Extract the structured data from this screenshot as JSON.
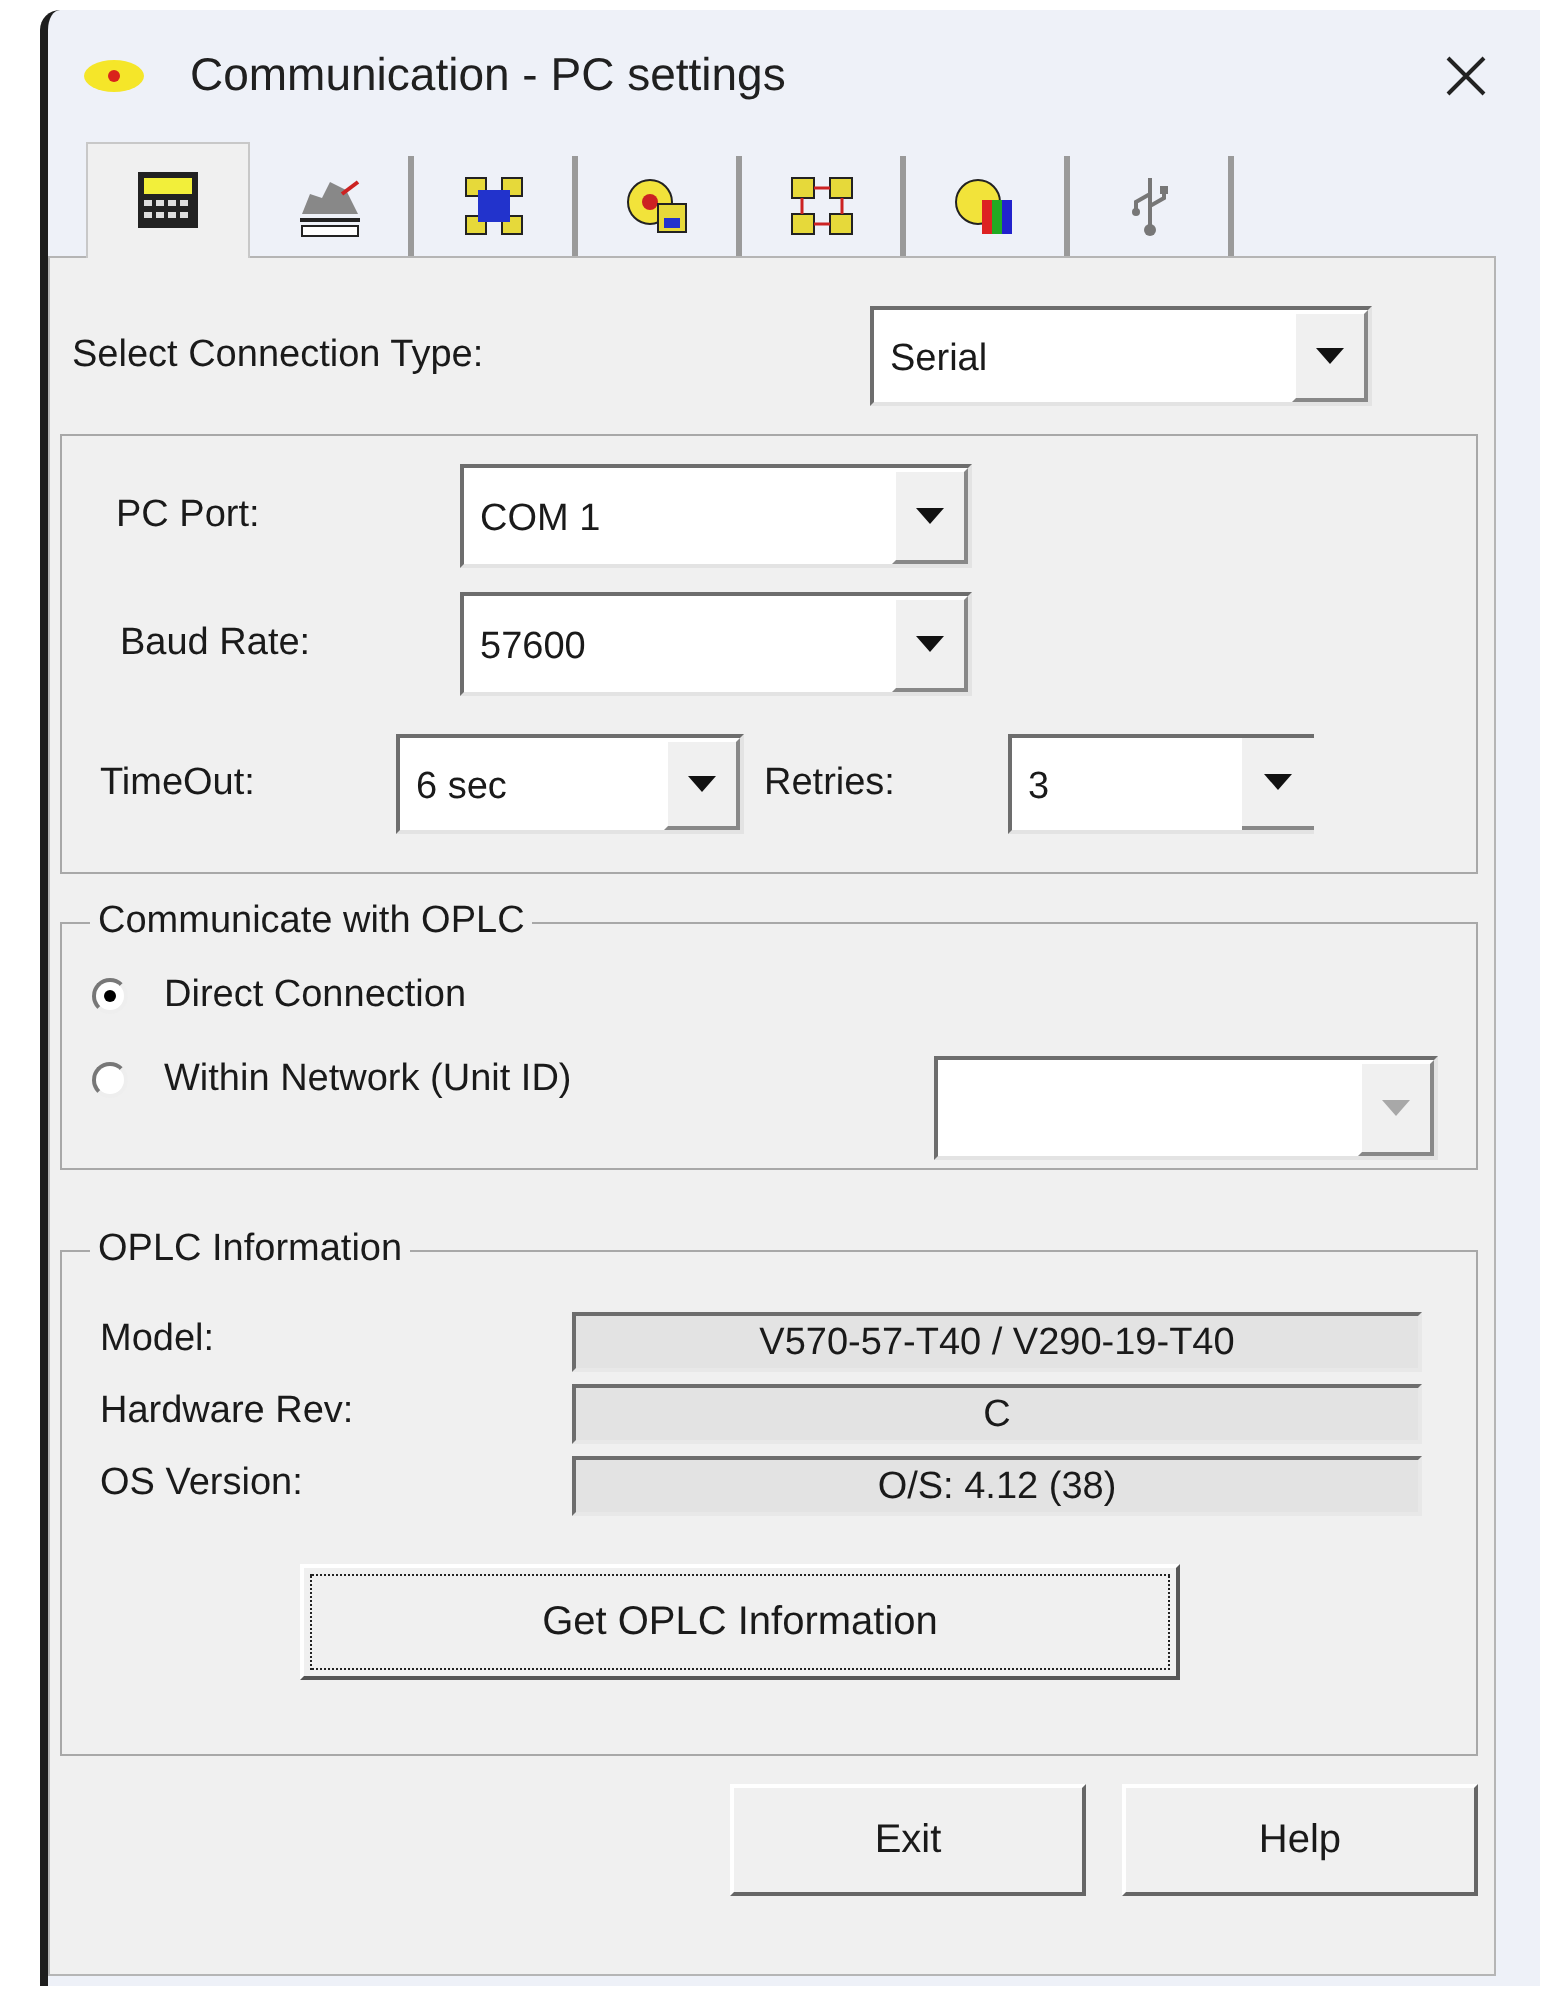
{
  "window": {
    "title": "Communication - PC settings"
  },
  "tabs": [
    {
      "kind": "keypad",
      "selected": true
    },
    {
      "kind": "machine",
      "selected": false
    },
    {
      "kind": "network",
      "selected": false
    },
    {
      "kind": "sun-panel",
      "selected": false
    },
    {
      "kind": "linked-nodes",
      "selected": false
    },
    {
      "kind": "color-panel",
      "selected": false
    },
    {
      "kind": "usb",
      "selected": false
    }
  ],
  "connection_type": {
    "label": "Select Connection Type:",
    "value": "Serial"
  },
  "serial": {
    "pc_port": {
      "label": "PC Port:",
      "value": "COM 1"
    },
    "baud_rate": {
      "label": "Baud Rate:",
      "value": "57600"
    },
    "timeout": {
      "label": "TimeOut:",
      "value": "6 sec"
    },
    "retries": {
      "label": "Retries:",
      "value": "3"
    }
  },
  "communicate": {
    "legend": "Communicate with OPLC",
    "options": [
      {
        "label": "Direct Connection",
        "selected": true
      },
      {
        "label": "Within Network (Unit ID)",
        "selected": false
      }
    ],
    "unit_id": {
      "disabled": true
    }
  },
  "info": {
    "legend": "OPLC Information",
    "rows": [
      {
        "label": "Model:",
        "value": "V570-57-T40 / V290-19-T40"
      },
      {
        "label": "Hardware Rev:",
        "value": "C"
      },
      {
        "label": "OS Version:",
        "value": "O/S: 4.12 (38)"
      }
    ],
    "button": {
      "label": "Get OPLC Information",
      "focused": true
    }
  },
  "buttons": [
    "Exit",
    "Help"
  ]
}
